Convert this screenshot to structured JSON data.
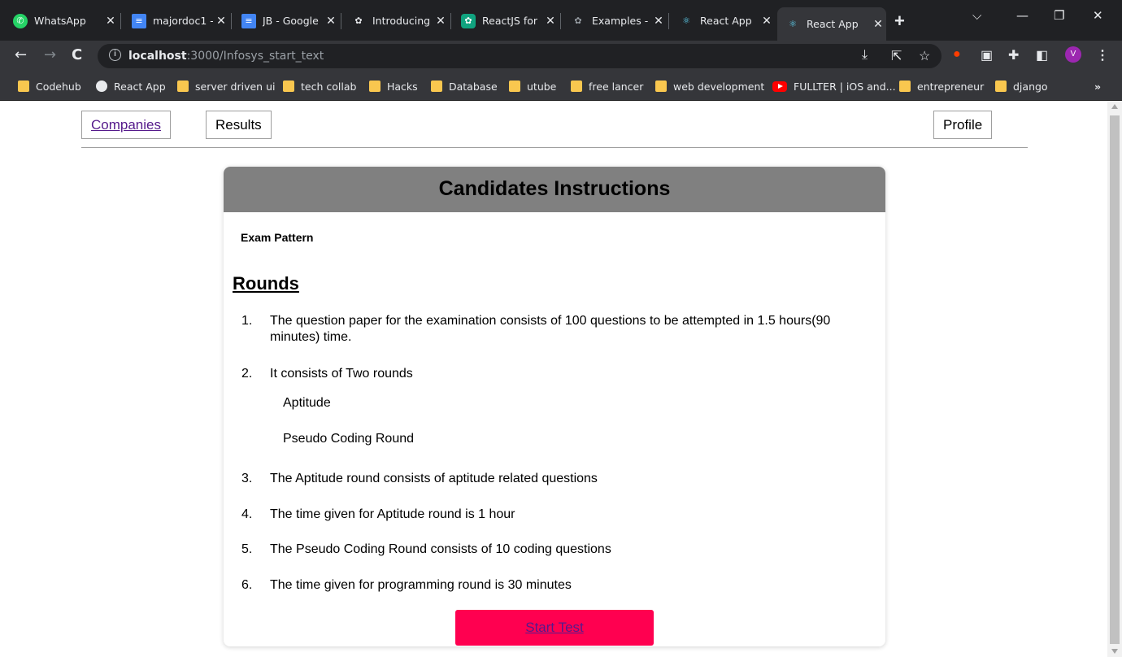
{
  "browser": {
    "tabs": [
      {
        "title": "WhatsApp",
        "icon": "whatsapp-icon"
      },
      {
        "title": "majordoc1 -",
        "icon": "google-docs-icon"
      },
      {
        "title": "JB - Google",
        "icon": "google-docs-icon"
      },
      {
        "title": "Introducing",
        "icon": "openai-icon"
      },
      {
        "title": "ReactJS for",
        "icon": "chatgpt-icon"
      },
      {
        "title": "Examples -",
        "icon": "openai-icon"
      },
      {
        "title": "React App",
        "icon": "react-icon"
      },
      {
        "title": "React App",
        "icon": "react-icon",
        "active": true
      }
    ],
    "url_host": "localhost",
    "url_rest": ":3000/Infosys_start_text",
    "profile_initial": "V",
    "bookmarks": [
      {
        "label": "Codehub",
        "icon": "folder-icon"
      },
      {
        "label": "React App",
        "icon": "globe-icon"
      },
      {
        "label": "server driven ui",
        "icon": "folder-icon"
      },
      {
        "label": "tech collab",
        "icon": "folder-icon"
      },
      {
        "label": "Hacks",
        "icon": "folder-icon"
      },
      {
        "label": "Database",
        "icon": "folder-icon"
      },
      {
        "label": "utube",
        "icon": "folder-icon"
      },
      {
        "label": "free lancer",
        "icon": "folder-icon"
      },
      {
        "label": "web development",
        "icon": "folder-icon"
      },
      {
        "label": "FULLTER | iOS and...",
        "icon": "youtube-icon"
      },
      {
        "label": "entrepreneur",
        "icon": "folder-icon"
      },
      {
        "label": "django",
        "icon": "folder-icon"
      }
    ],
    "bookmarks_more": "»"
  },
  "nav": {
    "companies": "Companies",
    "results": "Results",
    "profile": "Profile"
  },
  "card": {
    "title": "Candidates Instructions",
    "exam_pattern": "Exam Pattern",
    "rounds_heading": "Rounds",
    "items": [
      {
        "num": "1.",
        "text": "The question paper for the examination consists of 100 questions to be attempted in 1.5 hours(90 minutes) time."
      },
      {
        "num": "2.",
        "text": "It consists of Two rounds"
      },
      {
        "num": "3.",
        "text": "The Aptitude round consists of aptitude related questions"
      },
      {
        "num": "4.",
        "text": "The time given for Aptitude round is 1 hour"
      },
      {
        "num": "5.",
        "text": "The Pseudo Coding Round consists of 10 coding questions"
      },
      {
        "num": "6.",
        "text": "The time given for programming round is 30 minutes"
      }
    ],
    "subrounds": [
      "Aptitude",
      "Pseudo Coding Round"
    ],
    "start_button": "Start Test"
  },
  "colors": {
    "header_bg": "#808080",
    "start_button_bg": "#ff0050",
    "link": "#551a8b"
  }
}
